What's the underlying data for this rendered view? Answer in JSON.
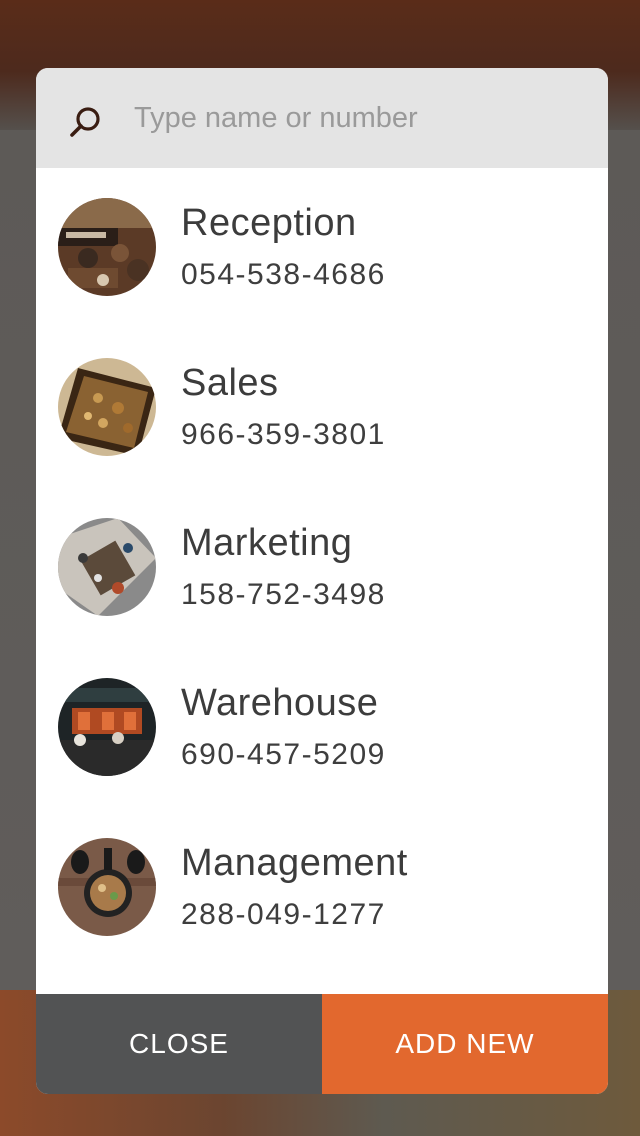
{
  "search": {
    "placeholder": "Type name or number",
    "icon": "search-icon"
  },
  "contacts": [
    {
      "name": "Reception",
      "phone": "054-538-4686",
      "avatar": "restaurant-interior-photo"
    },
    {
      "name": "Sales",
      "phone": "966-359-3801",
      "avatar": "baked-tray-photo"
    },
    {
      "name": "Marketing",
      "phone": "158-752-3498",
      "avatar": "aerial-tables-photo"
    },
    {
      "name": "Warehouse",
      "phone": "690-457-5209",
      "avatar": "storefront-photo"
    },
    {
      "name": "Management",
      "phone": "288-049-1277",
      "avatar": "pan-dish-photo"
    }
  ],
  "footer": {
    "close_label": "CLOSE",
    "add_label": "ADD NEW"
  },
  "colors": {
    "accent": "#e2682e",
    "close_button": "#525354",
    "search_bar": "#e4e4e4"
  }
}
